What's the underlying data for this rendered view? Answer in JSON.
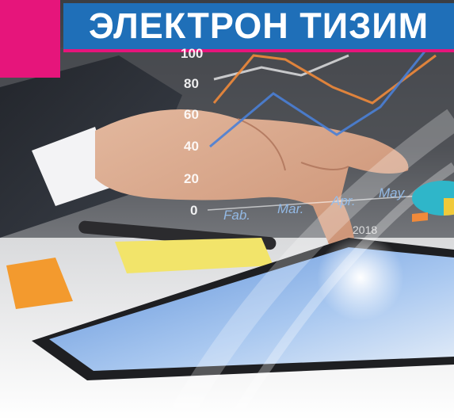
{
  "banner": {
    "title": "ЭЛЕКТРОН ТИЗИМ"
  },
  "overlay_chart": {
    "y_ticks": [
      "100",
      "80",
      "60",
      "40",
      "20",
      "0"
    ],
    "months": [
      "Fab.",
      "Mar.",
      "Apr.",
      "May."
    ],
    "year": "2018"
  },
  "colors": {
    "banner_blue": "#1f6fb8",
    "accent_pink": "#e6157b",
    "line_orange": "#f08a3a",
    "line_blue": "#4a7fd6"
  },
  "scene": {
    "image": "hands-on-tablet-with-chart-overlay"
  }
}
